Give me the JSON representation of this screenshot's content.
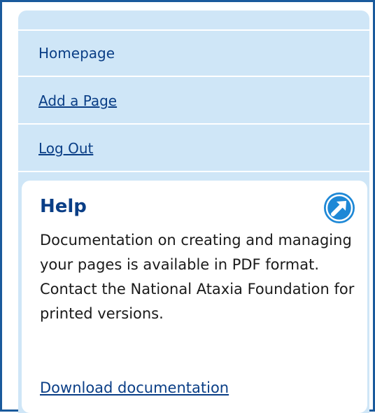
{
  "nav": {
    "items": [
      {
        "label": "Homepage"
      },
      {
        "label": "Add a Page"
      },
      {
        "label": "Log Out"
      }
    ]
  },
  "help": {
    "title": "Help",
    "icon": "arrow-up-right-circle-icon",
    "body": "Documentation on creating and managing your pages is available in PDF format. Contact the National Ataxia Foundation for printed versions.",
    "link": "Download documentation"
  },
  "colors": {
    "frame_border": "#1a5a9c",
    "panel_bg": "#cfe6f7",
    "link": "#0a3e86",
    "icon": "#1e88d6"
  }
}
